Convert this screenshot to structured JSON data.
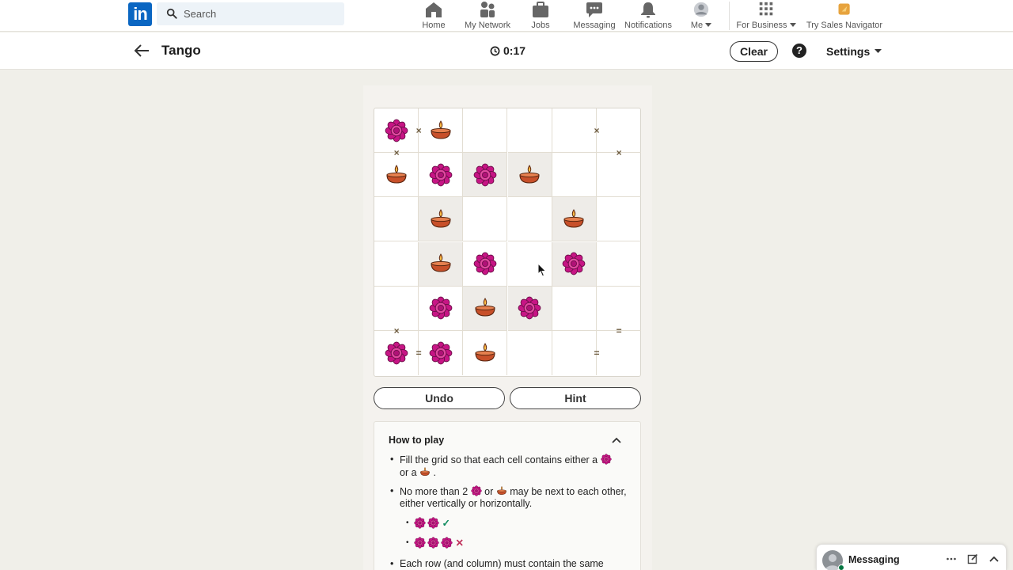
{
  "nav": {
    "search_placeholder": "Search",
    "items": [
      {
        "label": "Home",
        "icon": "home-icon"
      },
      {
        "label": "My Network",
        "icon": "network-icon"
      },
      {
        "label": "Jobs",
        "icon": "briefcase-icon"
      },
      {
        "label": "Messaging",
        "icon": "messaging-icon"
      },
      {
        "label": "Notifications",
        "icon": "bell-icon"
      },
      {
        "label": "Me",
        "icon": "avatar"
      },
      {
        "label": "For Business",
        "icon": "grid-icon"
      },
      {
        "label": "Try Sales Navigator",
        "icon": "sales-navigator-icon"
      }
    ]
  },
  "game": {
    "title": "Tango",
    "timer": "0:17",
    "clear_label": "Clear",
    "help_label": "?",
    "settings_label": "Settings",
    "undo_label": "Undo",
    "hint_label": "Hint",
    "grid_size": 6,
    "symbols": {
      "sun": "flower",
      "moon": "lamp"
    },
    "grid": [
      [
        "sun",
        "moon",
        "",
        "",
        "",
        ""
      ],
      [
        "moon",
        "sun",
        "sun",
        "moon",
        "",
        ""
      ],
      [
        "",
        "moon",
        "",
        "",
        "moon",
        ""
      ],
      [
        "",
        "moon",
        "sun",
        "",
        "sun",
        ""
      ],
      [
        "",
        "sun",
        "moon",
        "sun",
        "",
        ""
      ],
      [
        "sun",
        "sun",
        "moon",
        "",
        "",
        ""
      ]
    ],
    "locked": [
      [
        false,
        false,
        false,
        false,
        false,
        false
      ],
      [
        false,
        false,
        true,
        true,
        false,
        false
      ],
      [
        false,
        true,
        false,
        false,
        true,
        false
      ],
      [
        false,
        true,
        false,
        false,
        true,
        false
      ],
      [
        false,
        false,
        true,
        true,
        false,
        false
      ],
      [
        false,
        false,
        false,
        false,
        false,
        false
      ]
    ],
    "constraints": [
      {
        "between": [
          [
            0,
            0
          ],
          [
            0,
            1
          ]
        ],
        "sign": "×"
      },
      {
        "between": [
          [
            0,
            4
          ],
          [
            0,
            5
          ]
        ],
        "sign": "×"
      },
      {
        "between": [
          [
            0,
            0
          ],
          [
            1,
            0
          ]
        ],
        "sign": "×"
      },
      {
        "between": [
          [
            0,
            5
          ],
          [
            1,
            5
          ]
        ],
        "sign": "×"
      },
      {
        "between": [
          [
            4,
            0
          ],
          [
            5,
            0
          ]
        ],
        "sign": "×"
      },
      {
        "between": [
          [
            4,
            5
          ],
          [
            5,
            5
          ]
        ],
        "sign": "="
      },
      {
        "between": [
          [
            5,
            0
          ],
          [
            5,
            1
          ]
        ],
        "sign": "="
      },
      {
        "between": [
          [
            5,
            4
          ],
          [
            5,
            5
          ]
        ],
        "sign": "="
      }
    ]
  },
  "how_to_play": {
    "title": "How to play",
    "rule1_a": "Fill the grid so that each cell contains either a",
    "rule1_b": "or a",
    "rule1_c": ".",
    "rule2_a": "No more than 2",
    "rule2_b": "or",
    "rule2_c": "may be next to each other, either vertically or horizontally.",
    "ok_mark": "✓",
    "bad_mark": "✕",
    "rule3": "Each row (and column) must contain the same",
    "colors": {
      "ok": "#0f8b5f",
      "bad": "#c0325c"
    }
  },
  "messaging_dock": {
    "label": "Messaging"
  },
  "colors": {
    "brand": "#0a66c2",
    "sun_fill": "#c71585",
    "moon_fill": "#c8502a"
  }
}
